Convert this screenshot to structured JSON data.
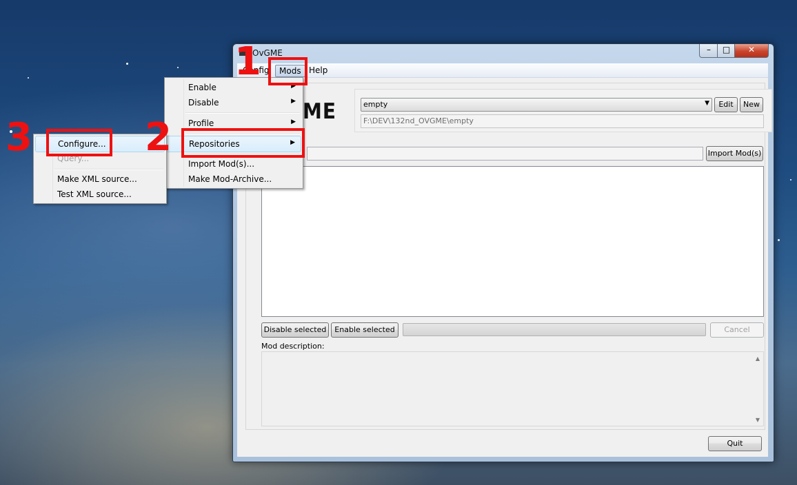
{
  "window": {
    "title": "OvGME",
    "caption_buttons": {
      "minimize": "–",
      "maximize": "□",
      "close": "✕"
    }
  },
  "menubar": {
    "config": "Config",
    "mods": "Mods",
    "help": "Help"
  },
  "logo_text": "ME",
  "profile": {
    "selected": "empty",
    "path": "F:\\DEV\\132nd_OVGME\\empty",
    "edit_label": "Edit",
    "new_label": "New"
  },
  "mods_panel": {
    "import_label": "Import Mod(s)",
    "disable_selected_label": "Disable selected",
    "enable_selected_label": "Enable selected",
    "cancel_label": "Cancel",
    "description_label": "Mod description:"
  },
  "quit_label": "Quit",
  "mods_menu": {
    "items": [
      {
        "label": "Enable",
        "submenu": true
      },
      {
        "label": "Disable",
        "submenu": true
      },
      {
        "label": "Profile",
        "submenu": true
      },
      {
        "label": "Repositories",
        "submenu": true
      },
      {
        "label": "Import Mod(s)...",
        "submenu": false
      },
      {
        "label": "Make Mod-Archive...",
        "submenu": false
      }
    ]
  },
  "repositories_menu": {
    "items": [
      {
        "label": "Configure...",
        "enabled": true
      },
      {
        "label": "Query...",
        "enabled": false
      },
      {
        "label": "Make XML source...",
        "enabled": true
      },
      {
        "label": "Test XML source...",
        "enabled": true
      }
    ]
  },
  "annotations": {
    "step1": "1",
    "step2": "2",
    "step3": "3"
  },
  "colors": {
    "annotation": "#ee1111",
    "desktop": "#1f4c80"
  }
}
